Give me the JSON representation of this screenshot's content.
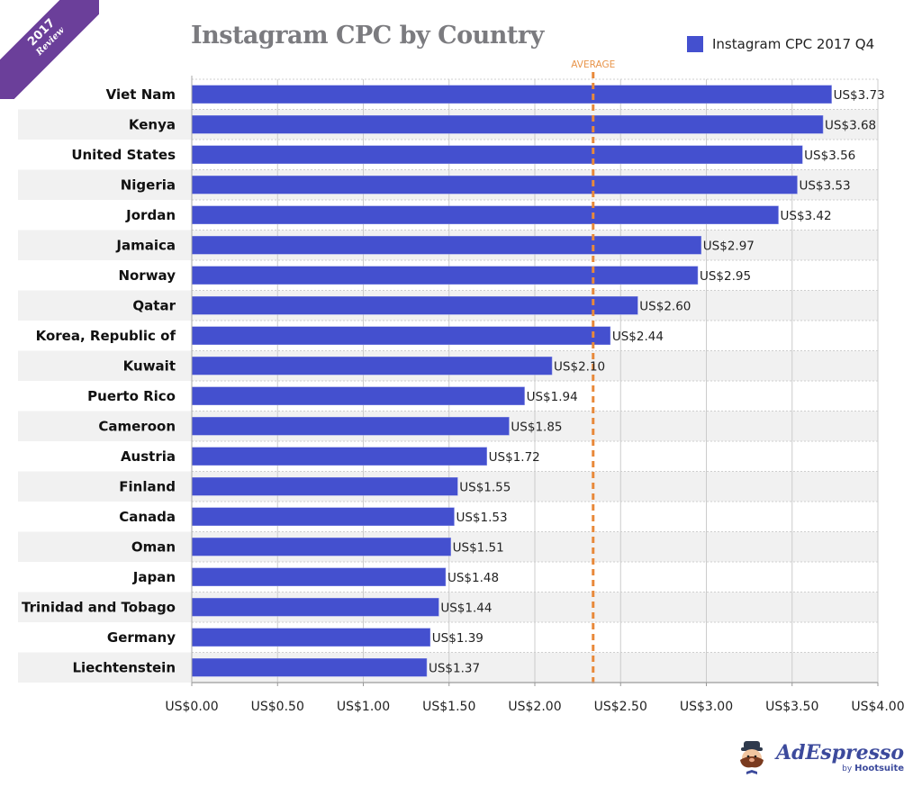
{
  "badge": {
    "year": "2017",
    "label": "Review"
  },
  "chart_data": {
    "type": "bar",
    "orientation": "horizontal",
    "title": "Instagram CPC by Country",
    "xlabel": "",
    "ylabel": "",
    "xlim": [
      0,
      4
    ],
    "x_ticks": [
      0,
      0.5,
      1,
      1.5,
      2,
      2.5,
      3,
      3.5,
      4
    ],
    "x_tick_labels": [
      "US$0.00",
      "US$0.50",
      "US$1.00",
      "US$1.50",
      "US$2.00",
      "US$2.50",
      "US$3.00",
      "US$3.50",
      "US$4.00"
    ],
    "grid": "vertical",
    "legend": {
      "position": "top-right",
      "entries": [
        "Instagram CPC 2017 Q4"
      ]
    },
    "series": [
      {
        "name": "Instagram CPC 2017 Q4",
        "color": "#4450cf",
        "values": [
          3.73,
          3.68,
          3.56,
          3.53,
          3.42,
          2.97,
          2.95,
          2.6,
          2.44,
          2.1,
          1.94,
          1.85,
          1.72,
          1.55,
          1.53,
          1.51,
          1.48,
          1.44,
          1.39,
          1.37
        ],
        "value_labels": [
          "US$3.73",
          "US$3.68",
          "US$3.56",
          "US$3.53",
          "US$3.42",
          "US$2.97",
          "US$2.95",
          "US$2.60",
          "US$2.44",
          "US$2.10",
          "US$1.94",
          "US$1.85",
          "US$1.72",
          "US$1.55",
          "US$1.53",
          "US$1.51",
          "US$1.48",
          "US$1.44",
          "US$1.39",
          "US$1.37"
        ]
      }
    ],
    "categories": [
      "Viet Nam",
      "Kenya",
      "United States",
      "Nigeria",
      "Jordan",
      "Jamaica",
      "Norway",
      "Qatar",
      "Korea, Republic of",
      "Kuwait",
      "Puerto Rico",
      "Cameroon",
      "Austria",
      "Finland",
      "Canada",
      "Oman",
      "Japan",
      "Trinidad and Tobago",
      "Germany",
      "Liechtenstein"
    ],
    "annotations": [
      {
        "type": "vertical-line",
        "label": "AVERAGE",
        "x": 2.34,
        "style": "dashed",
        "color": "#e8893a"
      }
    ]
  },
  "colors": {
    "bar": "#4450cf",
    "band": "#f1f1f1",
    "average": "#e8893a",
    "title": "#7b7b7f",
    "badge": "#6b3f9a"
  },
  "logo": {
    "name": "AdEspresso",
    "sub_prefix": "by",
    "sub_brand": "Hootsuite"
  }
}
